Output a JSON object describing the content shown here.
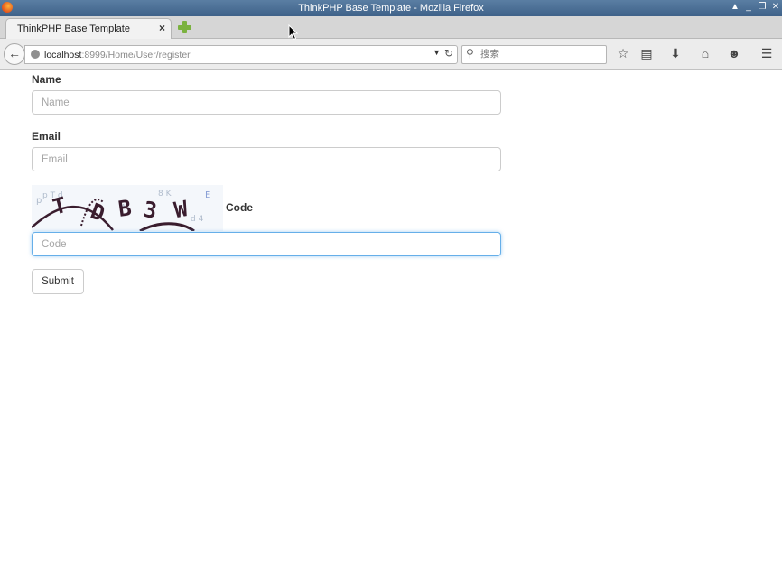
{
  "window": {
    "title": "ThinkPHP Base Template - Mozilla Firefox"
  },
  "tab": {
    "label": "ThinkPHP Base Template",
    "close": "×"
  },
  "nav": {
    "url_host": "localhost",
    "url_path": ":8999/Home/User/register",
    "search_placeholder": "搜索"
  },
  "form": {
    "name_label": "Name",
    "name_placeholder": "Name",
    "email_label": "Email",
    "email_placeholder": "Email",
    "captcha_text": "TDB3W",
    "code_label": "Code",
    "code_placeholder": "Code",
    "submit_label": "Submit"
  },
  "colors": {
    "titlebar": "#4a6d93",
    "focus_border": "#66afe9",
    "captcha_ink": "#3a1d2e"
  }
}
